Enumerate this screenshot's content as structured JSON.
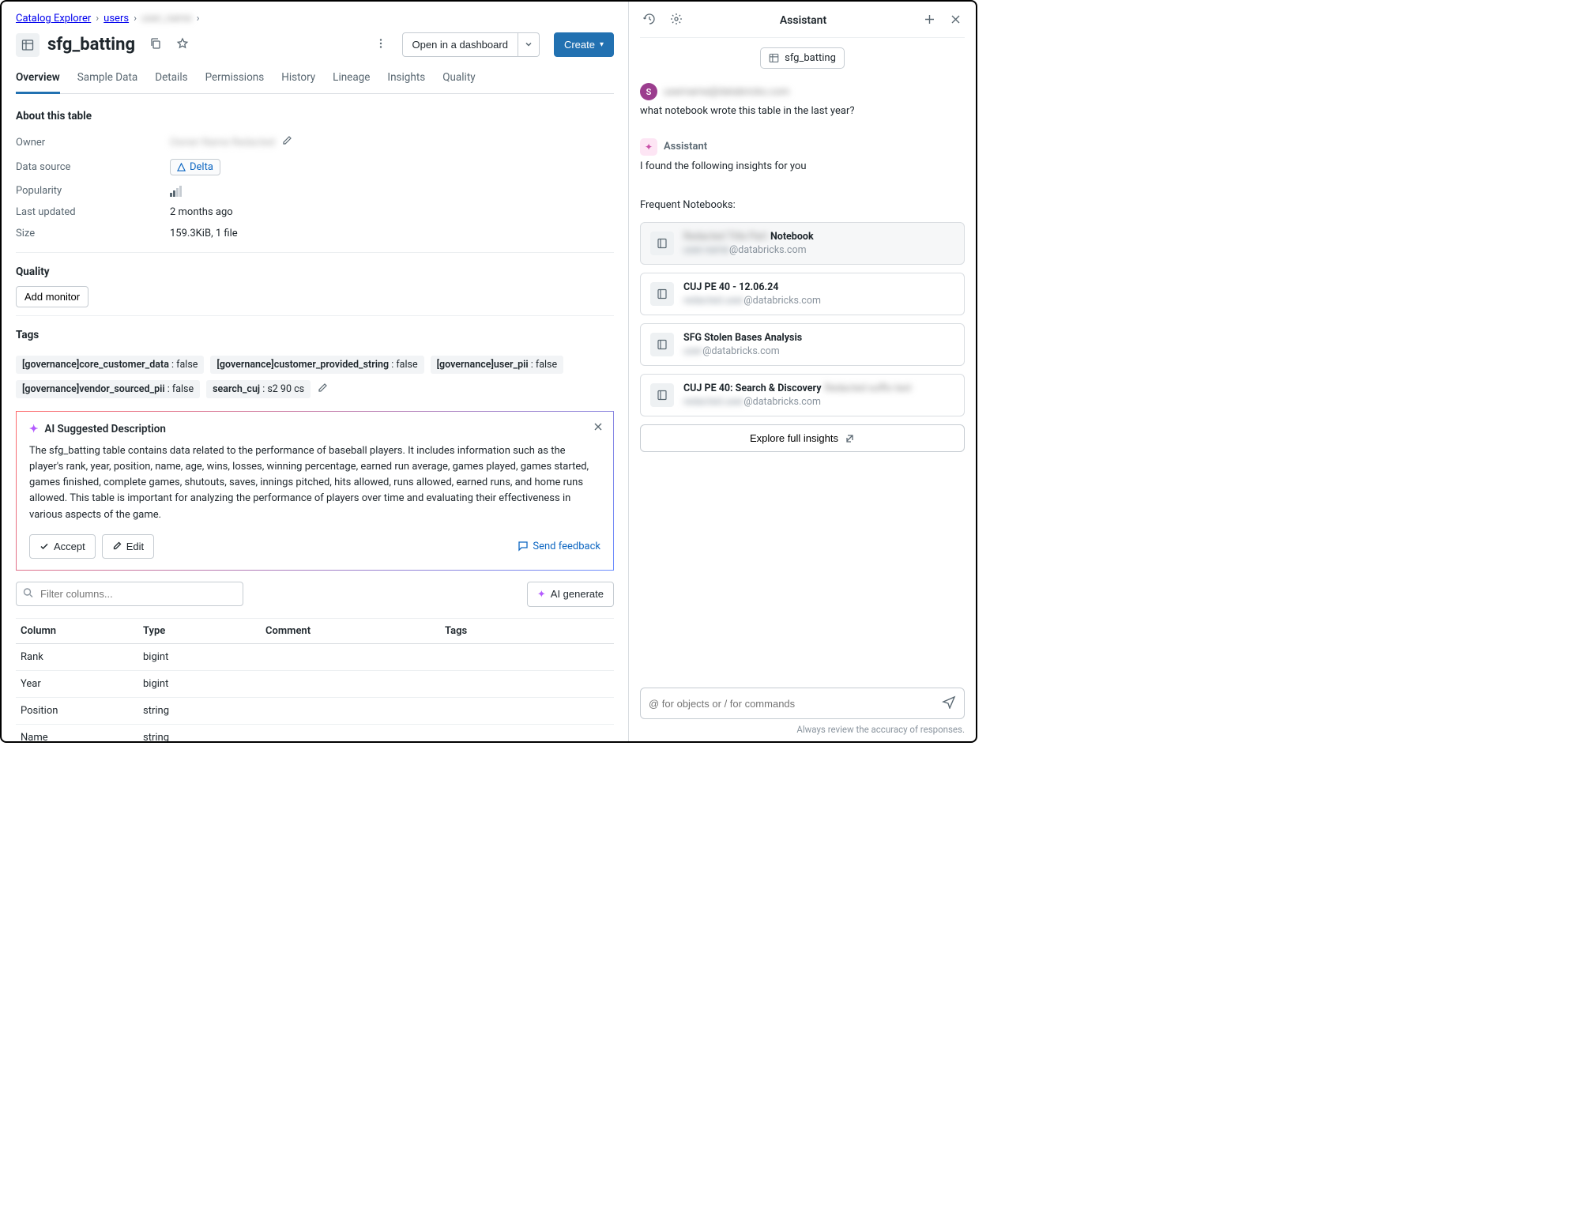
{
  "breadcrumb": {
    "root": "Catalog Explorer",
    "schema": "users",
    "owner_masked": "user_name"
  },
  "title": "sfg_batting",
  "header_buttons": {
    "open_dashboard": "Open in a dashboard",
    "create": "Create"
  },
  "tabs": [
    "Overview",
    "Sample Data",
    "Details",
    "Permissions",
    "History",
    "Lineage",
    "Insights",
    "Quality"
  ],
  "about": {
    "heading": "About this table",
    "owner_label": "Owner",
    "owner_value_masked": "Owner Name Redacted",
    "data_source_label": "Data source",
    "data_source_value": "Delta",
    "popularity_label": "Popularity",
    "last_updated_label": "Last updated",
    "last_updated_value": "2 months ago",
    "size_label": "Size",
    "size_value": "159.3KiB, 1 file"
  },
  "quality": {
    "heading": "Quality",
    "add_monitor": "Add monitor"
  },
  "tags": {
    "heading": "Tags",
    "items": [
      {
        "key": "[governance]core_customer_data",
        "value": "false"
      },
      {
        "key": "[governance]customer_provided_string",
        "value": "false"
      },
      {
        "key": "[governance]user_pii",
        "value": "false"
      },
      {
        "key": "[governance]vendor_sourced_pii",
        "value": "false"
      },
      {
        "key": "search_cuj",
        "value": "s2 90 cs"
      }
    ]
  },
  "ai": {
    "heading": "AI Suggested Description",
    "body": "The sfg_batting table contains data related to the performance of baseball players. It includes information such as the player's rank, year, position, name, age, wins, losses, winning percentage, earned run average, games played, games started, games finished, complete games, shutouts, saves, innings pitched, hits allowed, runs allowed, earned runs, and home runs allowed. This table is important for analyzing the performance of players over time and evaluating their effectiveness in various aspects of the game.",
    "accept": "Accept",
    "edit": "Edit",
    "feedback": "Send feedback"
  },
  "filter": {
    "placeholder": "Filter columns...",
    "ai_generate": "AI generate"
  },
  "columns": {
    "headers": [
      "Column",
      "Type",
      "Comment",
      "Tags"
    ],
    "rows": [
      {
        "name": "Rank",
        "type": "bigint"
      },
      {
        "name": "Year",
        "type": "bigint"
      },
      {
        "name": "Position",
        "type": "string"
      },
      {
        "name": "Name",
        "type": "string"
      }
    ]
  },
  "assistant": {
    "title": "Assistant",
    "context_chip": "sfg_batting",
    "user_name_masked": "username@databricks.com",
    "user_msg": "what notebook wrote this table in the last year?",
    "assistant_label": "Assistant",
    "assistant_msg": "I found the following insights for you",
    "section_label": "Frequent Notebooks:",
    "notebooks": [
      {
        "prefix_masked": "Redacted Title Part",
        "title": "Notebook",
        "sub_masked": "user.name",
        "domain": "@databricks.com",
        "hl": true
      },
      {
        "prefix_masked": "",
        "title": "CUJ PE 40 - 12.06.24",
        "sub_masked": "redacted.user",
        "domain": "@databricks.com",
        "hl": false
      },
      {
        "prefix_masked": "",
        "title": "SFG Stolen Bases Analysis",
        "sub_masked": "user",
        "domain": "@databricks.com",
        "hl": false
      },
      {
        "prefix_masked": "",
        "title": "CUJ PE 40: Search & Discovery",
        "suffix_masked": "Redacted suffix text",
        "sub_masked": "redacted.user",
        "domain": "@databricks.com",
        "hl": false
      }
    ],
    "explore": "Explore full insights",
    "input_placeholder": "@ for objects or / for commands",
    "footer": "Always review the accuracy of responses."
  }
}
